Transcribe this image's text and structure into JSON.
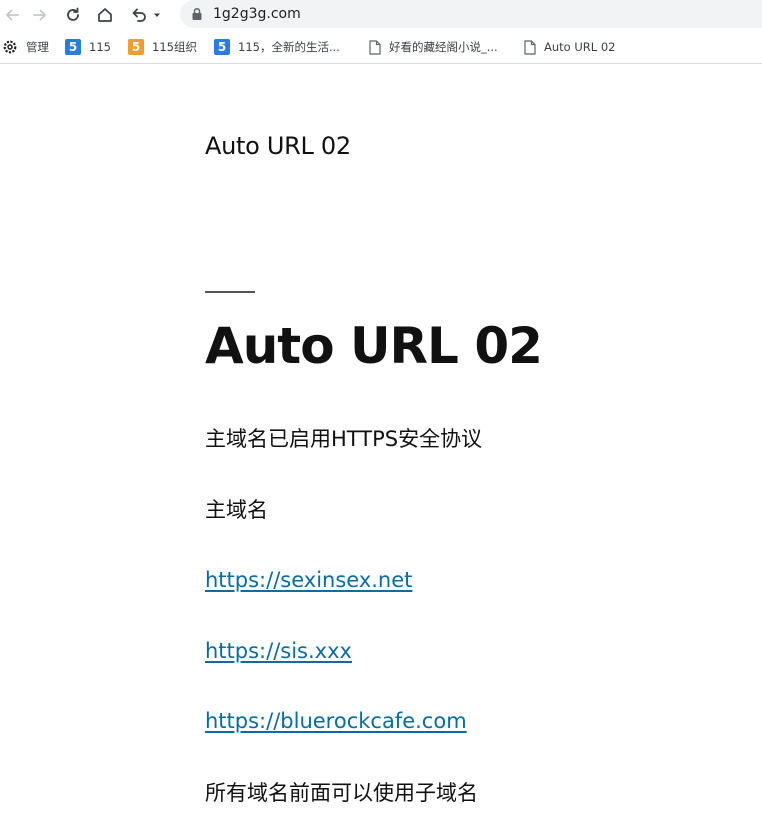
{
  "browser": {
    "url": "1g2g3g.com",
    "icons": {
      "back": "back-arrow-icon",
      "forward": "forward-arrow-icon",
      "reload": "reload-icon",
      "home": "home-icon",
      "history": "undo-arrow-icon",
      "lock": "lock-icon"
    }
  },
  "bookmarks": [
    {
      "label": "管理",
      "icon": "gear-icon"
    },
    {
      "label": "115",
      "icon": "five-blue-icon"
    },
    {
      "label": "115组织",
      "icon": "five-orange-icon"
    },
    {
      "label": "115，全新的生活...",
      "icon": "five-blue-icon"
    },
    {
      "label": "好看的藏经阁小说_...",
      "icon": "page-icon"
    },
    {
      "label": "Auto URL 02",
      "icon": "page-icon"
    }
  ],
  "page": {
    "site_title": "Auto URL 02",
    "entry_title": "Auto URL 02",
    "paragraphs": [
      "主域名已启用HTTPS安全协议",
      "主域名"
    ],
    "links": [
      "https://sexinsex.net",
      "https://sis.xxx",
      "https://bluerockcafe.com"
    ],
    "footer_paragraph": "所有域名前面可以使用子域名"
  },
  "colors": {
    "link": "#0a6ca5",
    "text": "#111111",
    "omnibox_bg": "#f1f3f4",
    "icon_blue": "#2b7be4",
    "icon_orange": "#f39c32"
  }
}
